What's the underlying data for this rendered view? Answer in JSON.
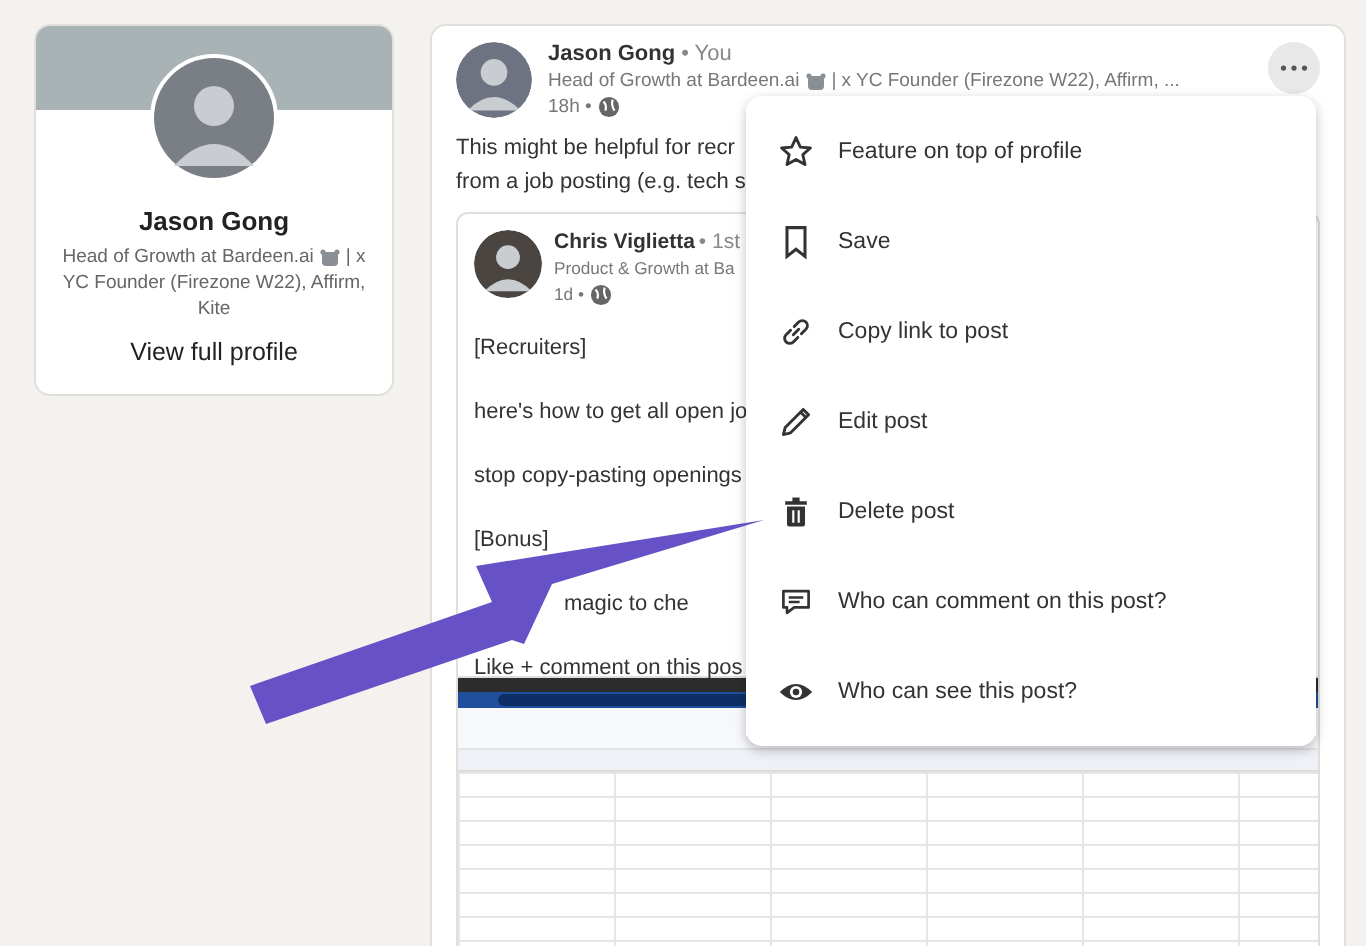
{
  "profile_card": {
    "name": "Jason Gong",
    "headline_start": "Head of Growth at Bardeen.ai",
    "headline_mid": "| x",
    "headline_end": "YC Founder (Firezone W22), Affirm, Kite",
    "link": "View full profile"
  },
  "post": {
    "author": "Jason Gong",
    "relation": "• You",
    "headline_start": "Head of Growth at Bardeen.ai",
    "headline_end": "| x YC Founder (Firezone W22), Affirm, ...",
    "time": "18h •",
    "text_lines": [
      "This might be helpful for recr",
      "from a job posting (e.g. tech s"
    ],
    "shared_post": {
      "author": "Chris Viglietta",
      "relation": "• 1st",
      "headline": "Product & Growth at Ba",
      "time": "1d •",
      "lines": [
        {
          "text": "[Recruiters]",
          "indent": false
        },
        {
          "text": "here's how to get all open jo",
          "indent": false
        },
        {
          "text": "stop copy-pasting openings",
          "indent": false
        },
        {
          "text": "[Bonus]",
          "indent": false
        },
        {
          "text": "magic to che",
          "indent": true
        },
        {
          "text": "Like + comment on this pos",
          "indent": false
        }
      ]
    }
  },
  "menu": [
    {
      "kind": "star",
      "label": "Feature on top of profile"
    },
    {
      "kind": "bookmark",
      "label": "Save"
    },
    {
      "kind": "link",
      "label": "Copy link to post"
    },
    {
      "kind": "pencil",
      "label": "Edit post"
    },
    {
      "kind": "trash",
      "label": "Delete post"
    },
    {
      "kind": "comment",
      "label": "Who can comment on this post?"
    },
    {
      "kind": "eye",
      "label": "Who can see this post?"
    }
  ]
}
